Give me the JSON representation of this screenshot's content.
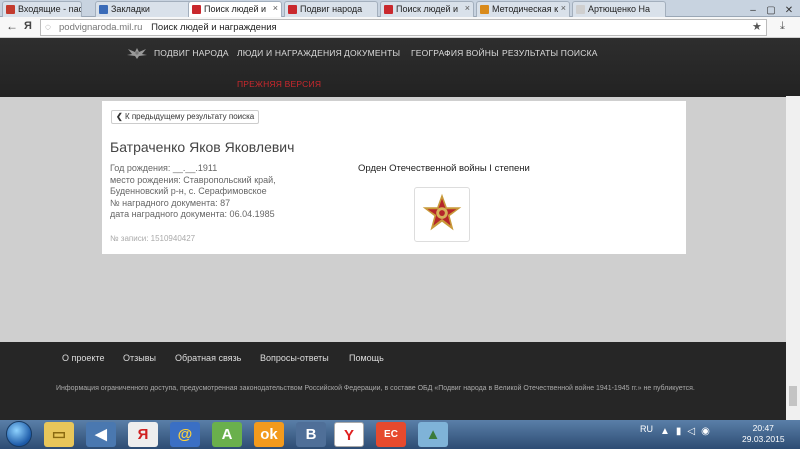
{
  "browser": {
    "tabs": [
      {
        "label": "Входящие - nad",
        "fav": "#c33b2e"
      },
      {
        "label": "Закладки",
        "fav": "#3a6bb8"
      },
      {
        "label": "Поиск людей и",
        "fav": "#c9282d"
      },
      {
        "label": "Подвиг народа",
        "fav": "#c9282d"
      },
      {
        "label": "Поиск людей и",
        "fav": "#c9282d"
      },
      {
        "label": "Методическая к",
        "fav": "#d98a1a"
      },
      {
        "label": "Артющенко На",
        "fav": "#cfcfcf"
      }
    ],
    "address": {
      "domain": "podvignaroda.mil.ru",
      "title": "Поиск людей и награждения"
    }
  },
  "site": {
    "nav": [
      "ПОДВИГ НАРОДА",
      "ЛЮДИ И НАГРАЖДЕНИЯ",
      "ДОКУМЕНТЫ",
      "ГЕОГРАФИЯ ВОЙНЫ",
      "РЕЗУЛЬТАТЫ ПОИСКА"
    ],
    "prev_version": "ПРЕЖНЯЯ ВЕРСИЯ"
  },
  "record": {
    "back_label": "К предыдущему результату поиска",
    "name": "Батраченко Яков Яковлевич",
    "birth_year": "Год рождения: __.__.1911",
    "birthplace_1": "место рождения: Ставропольский край,",
    "birthplace_2": "Буденновский р-н, с. Серафимовское",
    "doc_number": "№ наградного документа: 87",
    "doc_date": "дата наградного документа: 06.04.1985",
    "record_no": "№ записи: 1510940427",
    "award": "Орден Отечественной войны I степени"
  },
  "footer": {
    "links": [
      "О проекте",
      "Отзывы",
      "Обратная связь",
      "Вопросы-ответы",
      "Помощь"
    ],
    "note": "Информация ограниченного доступа, предусмотренная законодательством Российской Федерации, в составе ОБД «Подвиг народа в Великой Отечественной войне 1941-1945 гг.» не публикуется."
  },
  "taskbar": {
    "lang": "RU",
    "time": "20:47",
    "date": "29.03.2015"
  }
}
